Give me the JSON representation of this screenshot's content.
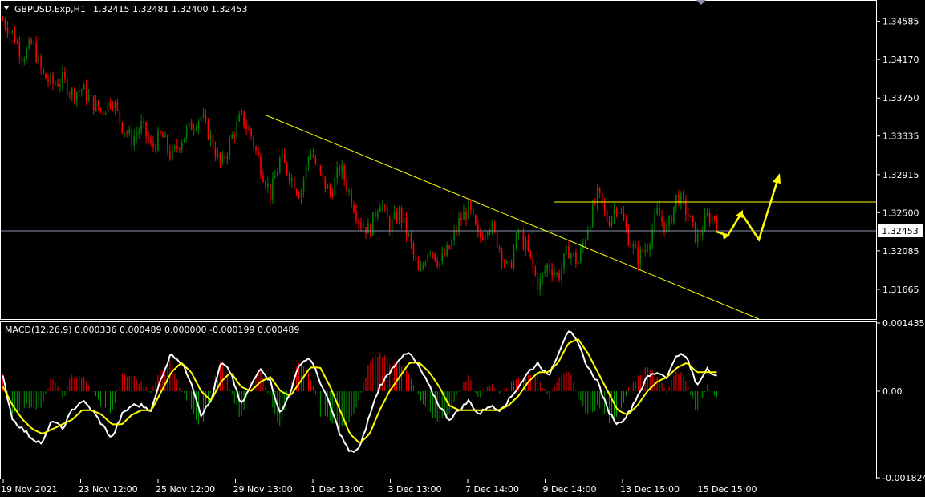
{
  "header": {
    "symbol_label": "GBPUSD.Exp,H1",
    "ohlc": "1.32415 1.32481 1.32400 1.32453"
  },
  "macd_header": "MACD(12,26,9) 0.000336 0.000489 0.000000 -0.000199 0.000489",
  "colors": {
    "background": "#000000",
    "bull": "#008000",
    "bear": "#ff0000",
    "trendline": "#ffff00",
    "macd_line": "#ffffff",
    "signal_line": "#ffff00",
    "hist_pos": "#ff0000",
    "hist_neg": "#00a000",
    "grid": "#ffffff"
  },
  "chart_data": [
    {
      "type": "candlestick",
      "name": "price",
      "ylim": [
        1.3135,
        1.348
      ],
      "yticks": [
        "1.34585",
        "1.34170",
        "1.33750",
        "1.33335",
        "1.32915",
        "1.32500",
        "1.32085",
        "1.31665"
      ],
      "current_price": "1.32453",
      "xticks": [
        "19 Nov 2021",
        "23 Nov 12:00",
        "25 Nov 12:00",
        "29 Nov 13:00",
        "1 Dec 13:00",
        "3 Dec 13:00",
        "7 Dec 14:00",
        "9 Dec 14:00",
        "13 Dec 15:00",
        "15 Dec 15:00"
      ],
      "close_path": [
        1.346,
        1.3445,
        1.342,
        1.3435,
        1.34,
        1.339,
        1.3395,
        1.338,
        1.3385,
        1.337,
        1.336,
        1.3375,
        1.3345,
        1.333,
        1.3345,
        1.332,
        1.3335,
        1.331,
        1.333,
        1.3345,
        1.3355,
        1.333,
        1.33,
        1.333,
        1.3355,
        1.3335,
        1.33,
        1.327,
        1.331,
        1.329,
        1.327,
        1.332,
        1.329,
        1.327,
        1.33,
        1.327,
        1.324,
        1.323,
        1.3265,
        1.3235,
        1.325,
        1.322,
        1.318,
        1.3215,
        1.3195,
        1.321,
        1.324,
        1.3255,
        1.322,
        1.324,
        1.3215,
        1.3185,
        1.323,
        1.3205,
        1.317,
        1.3195,
        1.318,
        1.321,
        1.3195,
        1.3235,
        1.327,
        1.324,
        1.326,
        1.3225,
        1.32,
        1.3215,
        1.325,
        1.323,
        1.327,
        1.325,
        1.322,
        1.3245,
        1.3246
      ]
    },
    {
      "type": "macd",
      "name": "MACD(12,26,9)",
      "ylim": [
        -0.001824,
        0.001435
      ],
      "yticks": [
        "0.001435",
        "0.00",
        "-0.001824"
      ],
      "macd_path": [
        0.0003,
        -0.0006,
        -0.0008,
        -0.001,
        -0.0011,
        -0.0006,
        -0.0008,
        -0.0004,
        -0.0002,
        -0.0004,
        -0.0007,
        -0.001,
        -0.0005,
        -0.0003,
        -0.0003,
        -0.0004,
        0.0003,
        0.0008,
        0.0006,
        0.0002,
        -0.0005,
        -0.0002,
        0.0006,
        0.0004,
        -0.0003,
        0.0001,
        0.0005,
        0.0002,
        -0.0005,
        0.0,
        0.0006,
        0.0007,
        0.0002,
        -0.0003,
        -0.0009,
        -0.0013,
        -0.0012,
        -0.0005,
        0.0001,
        0.0004,
        0.0007,
        0.0008,
        0.0005,
        0.0001,
        -0.0003,
        -0.0006,
        -0.0004,
        -0.0002,
        -0.0005,
        -0.0003,
        -0.0004,
        -0.0002,
        0.0001,
        0.0004,
        0.0006,
        0.0003,
        0.0008,
        0.0013,
        0.001,
        0.0005,
        0.0002,
        -0.0004,
        -0.0007,
        -0.0005,
        -0.0001,
        0.0003,
        0.0004,
        0.0003,
        0.0008,
        0.0007,
        0.0001,
        0.0005,
        0.0003
      ],
      "signal_path": [
        0.0001,
        -0.0003,
        -0.0006,
        -0.0008,
        -0.0009,
        -0.0008,
        -0.0007,
        -0.0006,
        -0.0004,
        -0.0004,
        -0.0005,
        -0.0007,
        -0.0007,
        -0.0005,
        -0.0004,
        -0.0004,
        0.0,
        0.0004,
        0.0006,
        0.0004,
        0.0,
        -0.0002,
        0.0002,
        0.0004,
        0.0001,
        0.0,
        0.0002,
        0.0003,
        0.0,
        -0.0001,
        0.0002,
        0.0005,
        0.0005,
        0.0001,
        -0.0004,
        -0.0009,
        -0.0011,
        -0.0009,
        -0.0004,
        0.0,
        0.0003,
        0.0006,
        0.0006,
        0.0004,
        0.0001,
        -0.0003,
        -0.0004,
        -0.0004,
        -0.0004,
        -0.0004,
        -0.0004,
        -0.0003,
        -0.0001,
        0.0002,
        0.0004,
        0.0004,
        0.0006,
        0.001,
        0.0011,
        0.0008,
        0.0004,
        0.0,
        -0.0004,
        -0.0005,
        -0.0003,
        0.0,
        0.0002,
        0.0003,
        0.0005,
        0.0006,
        0.0004,
        0.0004,
        0.0004
      ]
    }
  ]
}
